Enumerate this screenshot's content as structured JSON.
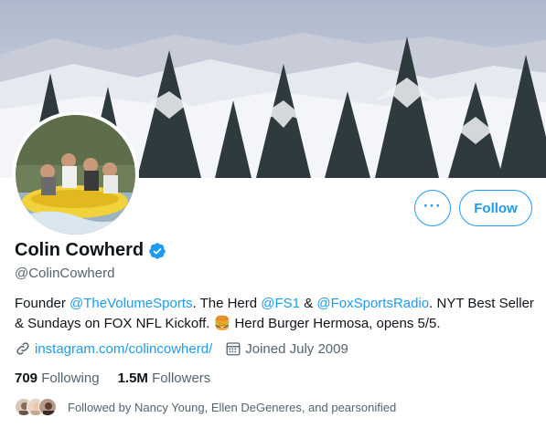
{
  "profile": {
    "name": "Colin Cowherd",
    "handle": "@ColinCowherd",
    "verified": true
  },
  "actions": {
    "more_label": "···",
    "follow_label": "Follow"
  },
  "bio": {
    "part1": "Founder ",
    "mention1": "@TheVolumeSports",
    "part2": ". The Herd ",
    "mention2": "@FS1",
    "part3": " & ",
    "mention3": "@FoxSportsRadio",
    "part4": ". NYT Best Seller & Sundays on FOX NFL Kickoff. 🍔 Herd Burger Hermosa, opens 5/5."
  },
  "meta": {
    "link_icon": "link-icon",
    "website": "instagram.com/colincowherd/",
    "calendar_icon": "calendar-icon",
    "joined": "Joined July 2009"
  },
  "counts": {
    "following_count": "709",
    "following_label": "Following",
    "followers_count": "1.5M",
    "followers_label": "Followers"
  },
  "followed_by": {
    "text": "Followed by Nancy Young, Ellen DeGeneres, and pearsonified"
  },
  "colors": {
    "accent": "#1d9bf0",
    "text": "#0f1419",
    "muted": "#536471"
  }
}
